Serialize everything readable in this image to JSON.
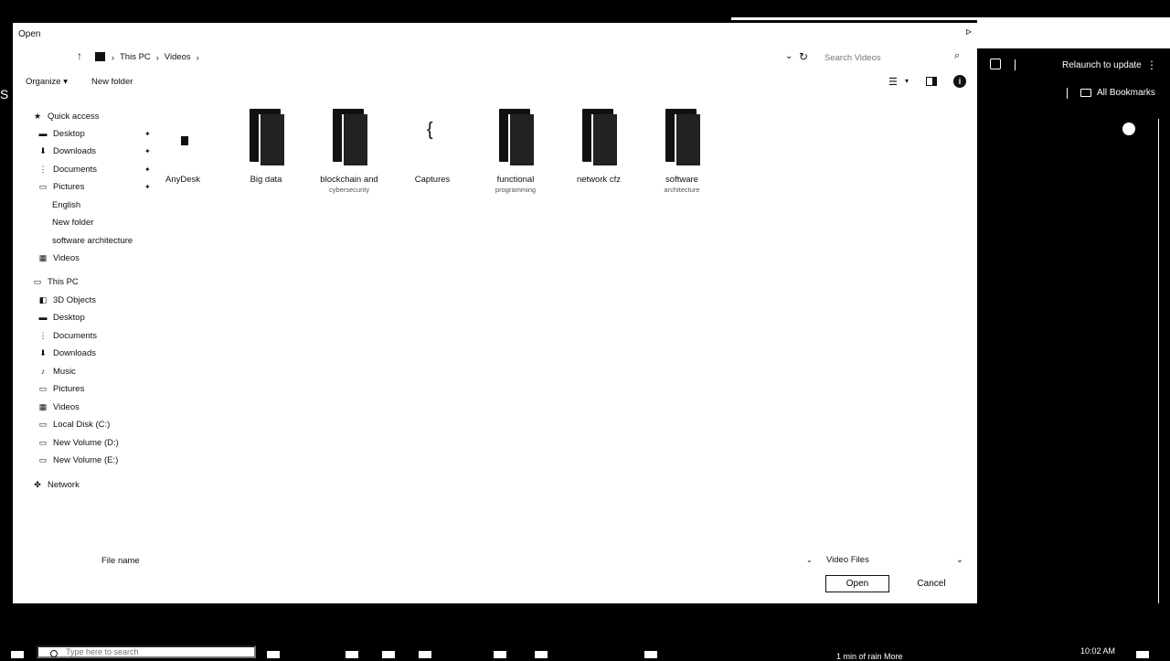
{
  "dialog": {
    "title": "Open",
    "close_icon": "close-icon"
  },
  "address": {
    "crumbs": [
      "This PC",
      "Videos"
    ],
    "search_placeholder": "Search Videos"
  },
  "toolbar": {
    "organize": "Organize",
    "new_folder": "New folder"
  },
  "nav": {
    "quick_access": "Quick access",
    "quick_items": [
      {
        "label": "Desktop",
        "icon": "desktop-icon",
        "pinned": true
      },
      {
        "label": "Downloads",
        "icon": "download-icon",
        "pinned": true
      },
      {
        "label": "Documents",
        "icon": "document-icon",
        "pinned": true
      },
      {
        "label": "Pictures",
        "icon": "picture-icon",
        "pinned": true
      },
      {
        "label": "English",
        "icon": "folder-icon",
        "pinned": false
      },
      {
        "label": "New folder",
        "icon": "folder-icon",
        "pinned": false
      },
      {
        "label": "software architecture",
        "icon": "folder-icon",
        "pinned": false
      },
      {
        "label": "Videos",
        "icon": "video-icon",
        "pinned": false
      }
    ],
    "this_pc": "This PC",
    "pc_items": [
      {
        "label": "3D Objects",
        "icon": "cube-icon"
      },
      {
        "label": "Desktop",
        "icon": "desktop-icon"
      },
      {
        "label": "Documents",
        "icon": "document-icon"
      },
      {
        "label": "Downloads",
        "icon": "download-icon"
      },
      {
        "label": "Music",
        "icon": "music-icon"
      },
      {
        "label": "Pictures",
        "icon": "picture-icon"
      },
      {
        "label": "Videos",
        "icon": "video-icon"
      },
      {
        "label": "Local Disk (C:)",
        "icon": "drive-icon"
      },
      {
        "label": "New Volume (D:)",
        "icon": "drive-icon"
      },
      {
        "label": "New Volume (E:)",
        "icon": "drive-icon"
      }
    ],
    "network": "Network"
  },
  "files": [
    {
      "label": "AnyDesk",
      "sub": ""
    },
    {
      "label": "Big data",
      "sub": ""
    },
    {
      "label": "blockchain and",
      "sub": "cybersecurity"
    },
    {
      "label": "Captures",
      "sub": ""
    },
    {
      "label": "functional",
      "sub": "programming"
    },
    {
      "label": "network cfz",
      "sub": ""
    },
    {
      "label": "software",
      "sub": "architecture"
    }
  ],
  "footer": {
    "file_name_label": "File name",
    "file_type": "Video Files",
    "open": "Open",
    "cancel": "Cancel"
  },
  "browser": {
    "relaunch": "Relaunch to update",
    "all_bookmarks": "All Bookmarks"
  },
  "taskbar": {
    "search_placeholder": "Type here to search",
    "tray_text": "1 min of rain More",
    "time": "10:02 AM"
  }
}
